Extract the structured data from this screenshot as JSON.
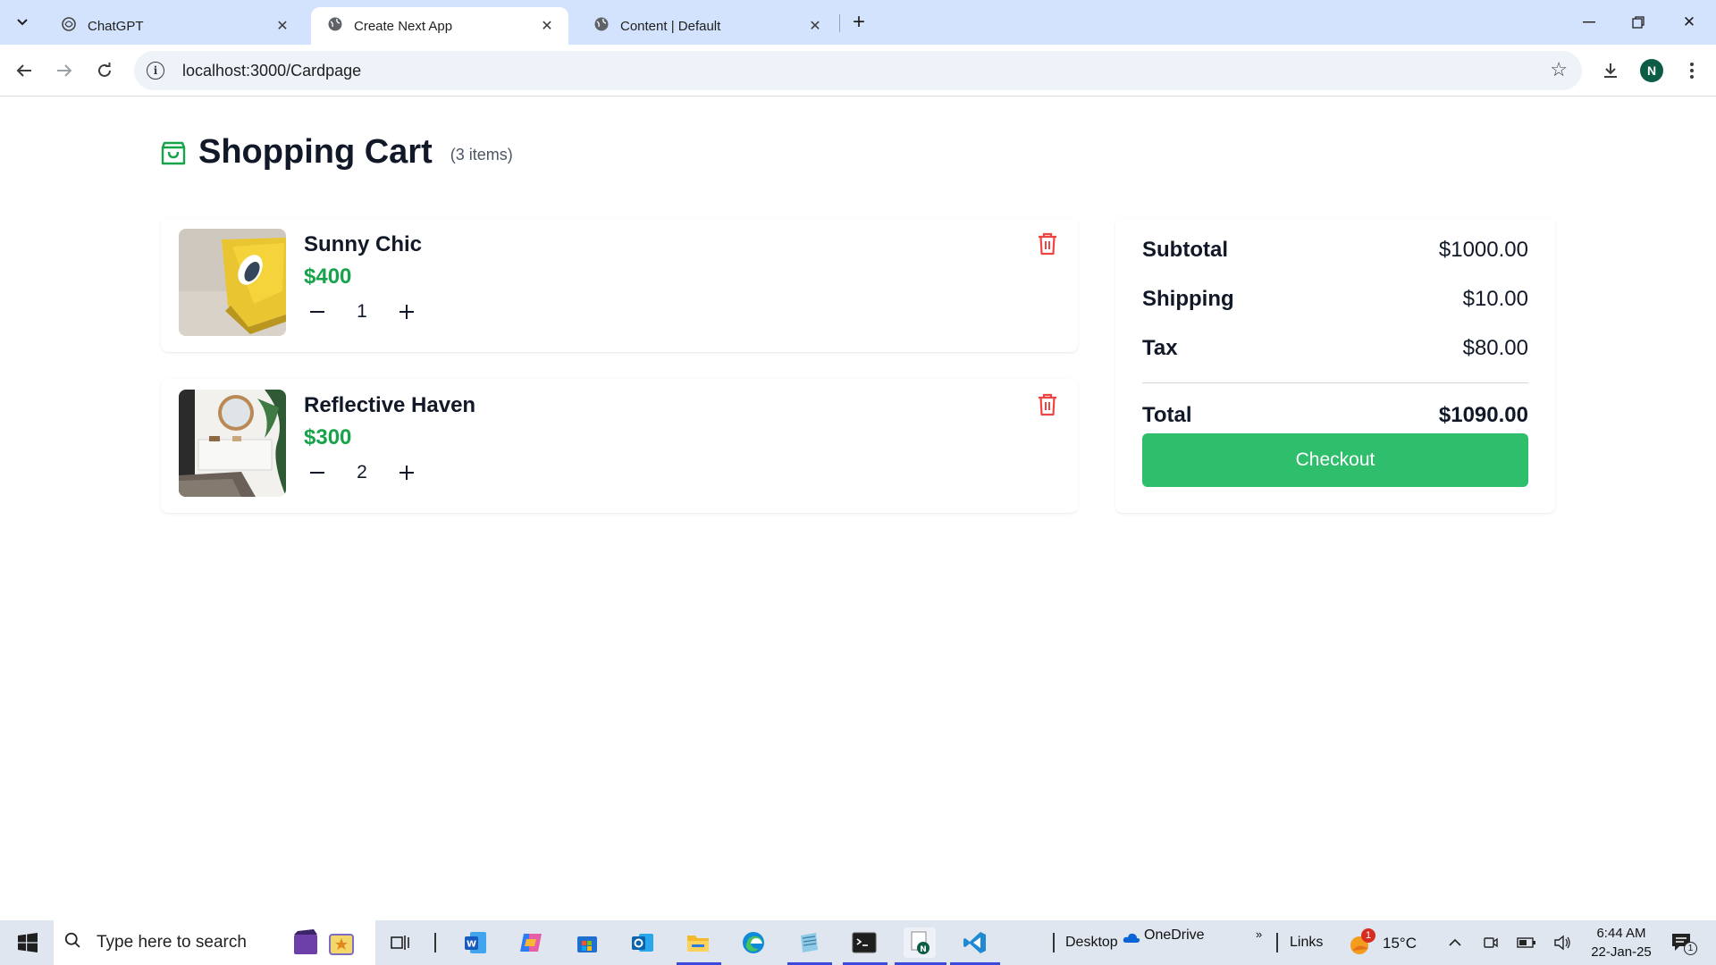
{
  "browser": {
    "tabs": [
      {
        "title": "ChatGPT",
        "icon": "chatgpt-icon",
        "active": false
      },
      {
        "title": "Create Next App",
        "icon": "globe-icon",
        "active": true
      },
      {
        "title": "Content | Default",
        "icon": "globe-icon",
        "active": false
      }
    ],
    "url": "localhost:3000/Cardpage",
    "profile_initial": "N"
  },
  "cart": {
    "title": "Shopping Cart",
    "item_count": "(3 items)",
    "items": [
      {
        "name": "Sunny Chic",
        "price": "$400",
        "quantity": "1",
        "image": "yellow-chair-photo"
      },
      {
        "name": "Reflective Haven",
        "price": "$300",
        "quantity": "2",
        "image": "bedroom-mirror-photo"
      }
    ],
    "accent_color": "#16a34a",
    "delete_color": "#ef4444"
  },
  "summary": {
    "subtotal_label": "Subtotal",
    "subtotal_value": "$1000.00",
    "shipping_label": "Shipping",
    "shipping_value": "$10.00",
    "tax_label": "Tax",
    "tax_value": "$80.00",
    "total_label": "Total",
    "total_value": "$1090.00",
    "checkout_label": "Checkout",
    "checkout_color": "#2ebe6c"
  },
  "taskbar": {
    "search_placeholder": "Type here to search",
    "desktop_label": "Desktop",
    "onedrive_label": "OneDrive",
    "links_label": "Links",
    "weather": "15°C",
    "weather_badge": "1",
    "time": "6:44 AM",
    "date": "22-Jan-25",
    "notification_count": "1"
  }
}
